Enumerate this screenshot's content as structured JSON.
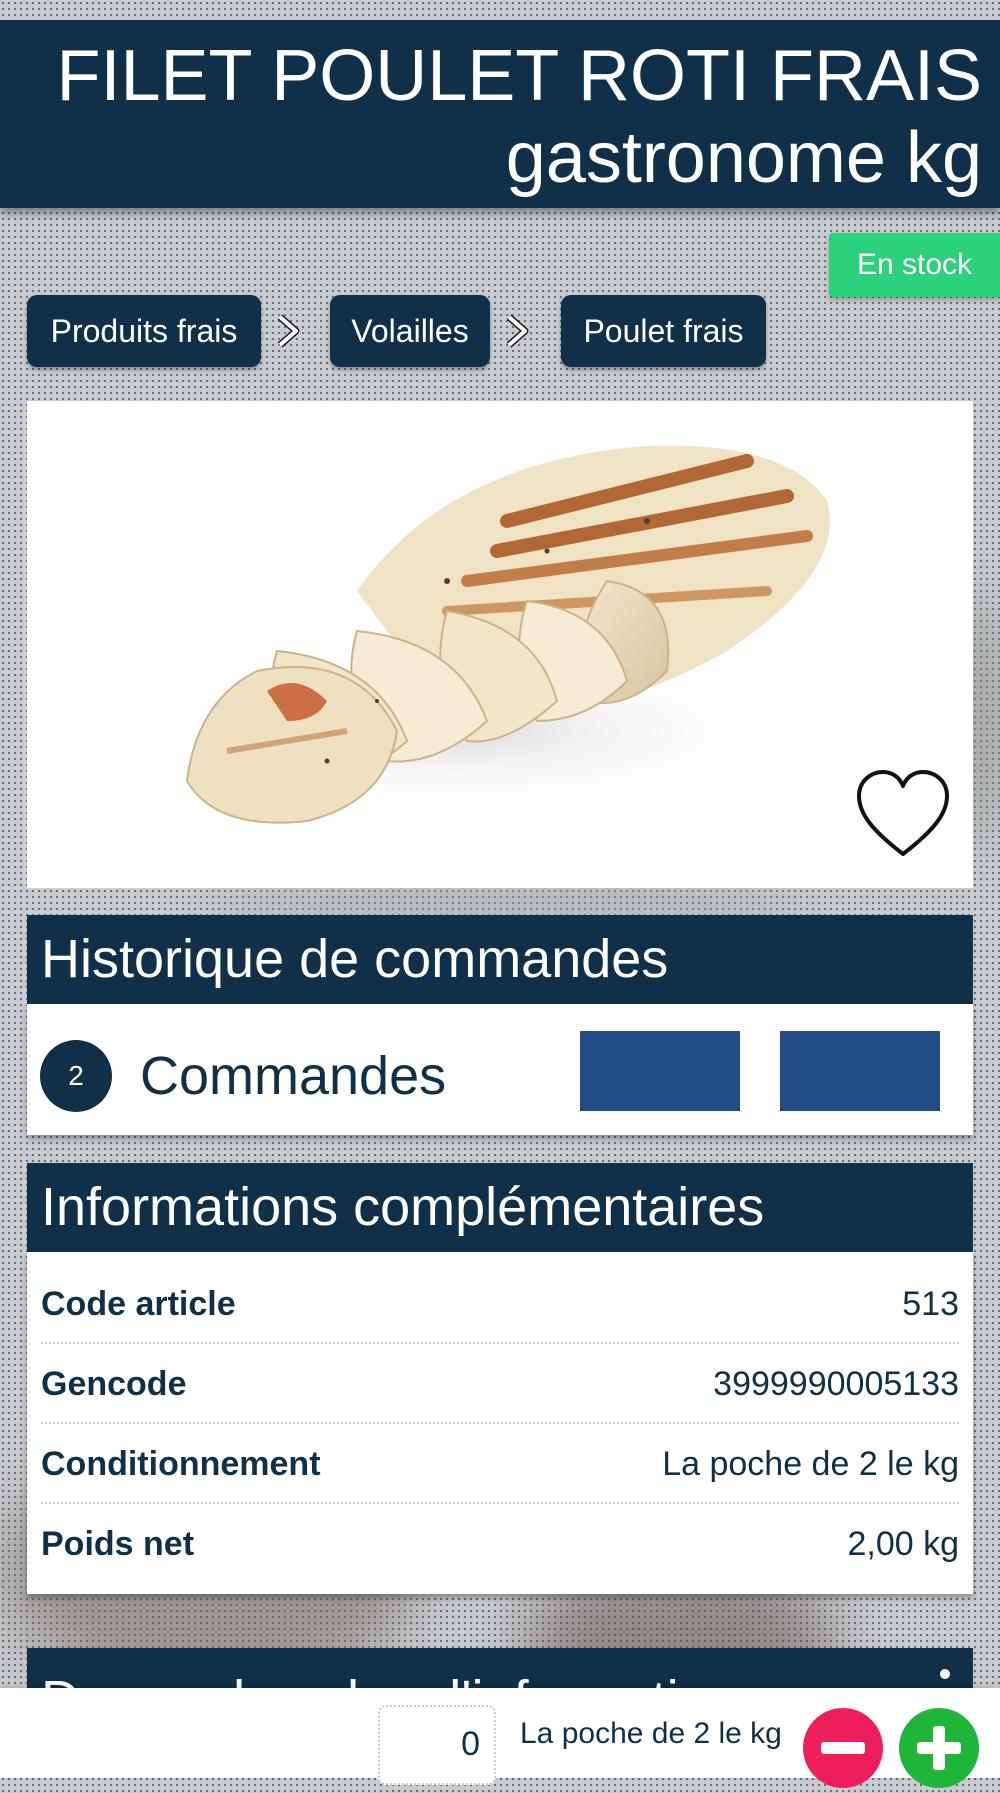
{
  "product": {
    "title_line1": "FILET POULET ROTI FRAIS",
    "title_line2": "gastronome kg",
    "stock_status": "En stock",
    "image_alt": "grilled-sliced-chicken-breast"
  },
  "breadcrumb": [
    {
      "label": "Produits frais"
    },
    {
      "label": "Volailles"
    },
    {
      "label": "Poulet frais"
    }
  ],
  "order_history": {
    "header": "Historique de commandes",
    "count": "2",
    "label": "Commandes"
  },
  "info": {
    "header": "Informations complémentaires",
    "rows": [
      {
        "key": "Code article",
        "value": "513"
      },
      {
        "key": "Gencode",
        "value": "3999990005133"
      },
      {
        "key": "Conditionnement",
        "value": "La poche de 2 le kg"
      },
      {
        "key": "Poids net",
        "value": "2,00 kg"
      }
    ]
  },
  "contact": {
    "header": "Demandez plus d'information"
  },
  "cart": {
    "quantity": "0",
    "unit": "La poche de 2 le kg"
  },
  "colors": {
    "primary_navy": "#0f3048",
    "in_stock_green": "#2bd27b",
    "order_button_blue": "#234b86",
    "minus_pink": "#ee1e5a",
    "plus_green": "#1eb53a"
  },
  "icons": {
    "breadcrumb_separator": "chevron-right-icon",
    "favorite": "heart-icon",
    "decrease": "minus-icon",
    "increase": "plus-icon",
    "more": "more-vertical-icon"
  }
}
